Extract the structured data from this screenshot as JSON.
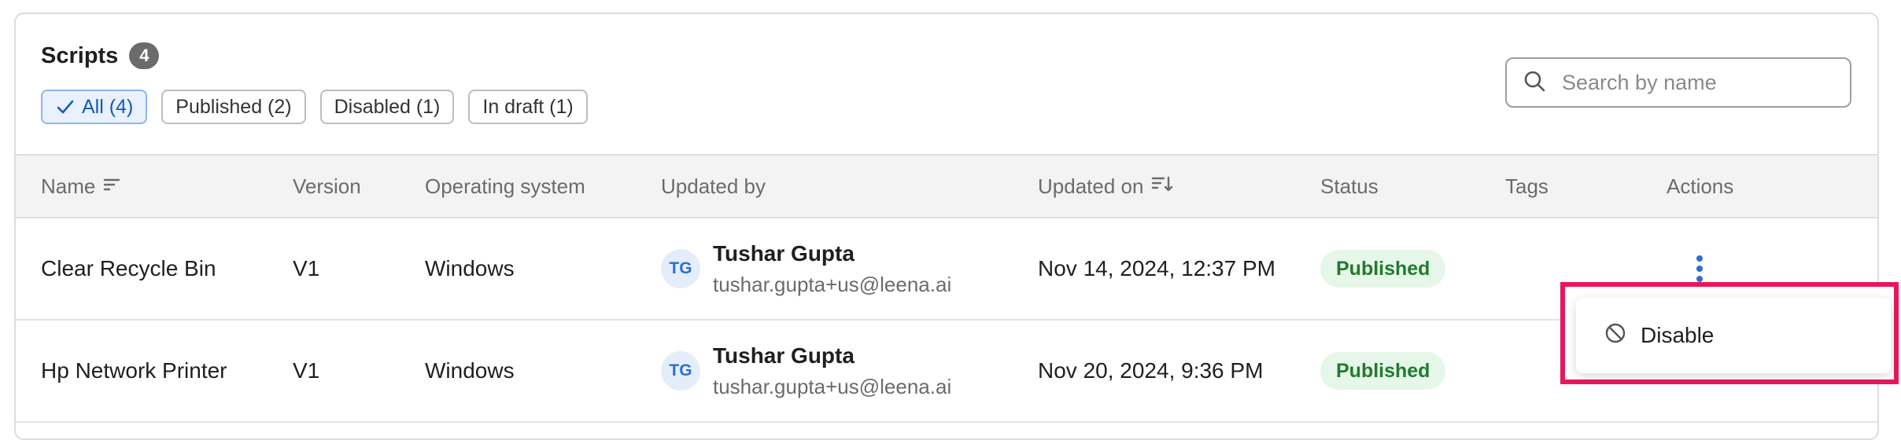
{
  "header": {
    "title": "Scripts",
    "count": "4"
  },
  "filters": [
    {
      "label": "All (4)",
      "active": true
    },
    {
      "label": "Published (2)",
      "active": false
    },
    {
      "label": "Disabled (1)",
      "active": false
    },
    {
      "label": "In draft (1)",
      "active": false
    }
  ],
  "search": {
    "placeholder": "Search by name",
    "value": ""
  },
  "columns": {
    "name": "Name",
    "version": "Version",
    "os": "Operating system",
    "updated_by": "Updated by",
    "updated_on": "Updated on",
    "status": "Status",
    "tags": "Tags",
    "actions": "Actions"
  },
  "rows": [
    {
      "name": "Clear Recycle Bin",
      "version": "V1",
      "os": "Windows",
      "initials": "TG",
      "user_name": "Tushar Gupta",
      "user_email": "tushar.gupta+us@leena.ai",
      "updated_on": "Nov 14, 2024, 12:37 PM",
      "status": "Published",
      "tags": ""
    },
    {
      "name": "Hp Network Printer",
      "version": "V1",
      "os": "Windows",
      "initials": "TG",
      "user_name": "Tushar Gupta",
      "user_email": "tushar.gupta+us@leena.ai",
      "updated_on": "Nov 20, 2024, 9:36 PM",
      "status": "Published",
      "tags": ""
    }
  ],
  "action_menu": {
    "items": [
      {
        "label": "Disable",
        "icon": "disable-icon"
      }
    ]
  },
  "colors": {
    "accent": "#2b6fd1",
    "published_bg": "#e6f6e8",
    "published_text": "#237a2f",
    "highlight": "#e8175d"
  }
}
